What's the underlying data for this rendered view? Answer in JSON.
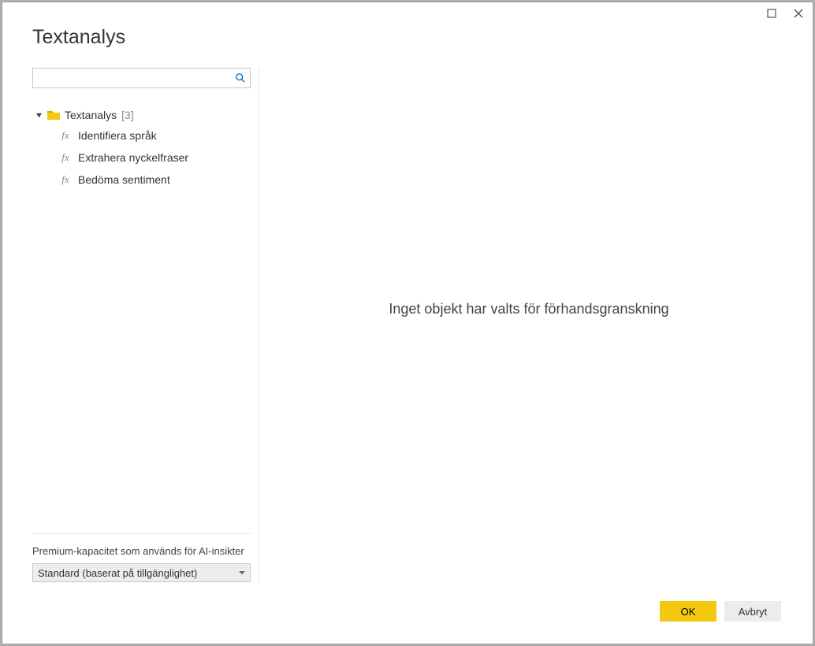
{
  "dialog": {
    "title": "Textanalys"
  },
  "search": {
    "value": "",
    "placeholder": ""
  },
  "tree": {
    "folder_label": "Textanalys",
    "folder_count": "[3]",
    "items": [
      {
        "label": "Identifiera språk"
      },
      {
        "label": "Extrahera nyckelfraser"
      },
      {
        "label": "Bedöma sentiment"
      }
    ]
  },
  "capacity": {
    "label": "Premium-kapacitet som används för AI-insikter",
    "selected": "Standard (baserat på tillgänglighet)"
  },
  "preview": {
    "placeholder": "Inget objekt har valts för förhandsgranskning"
  },
  "buttons": {
    "ok": "OK",
    "cancel": "Avbryt"
  }
}
